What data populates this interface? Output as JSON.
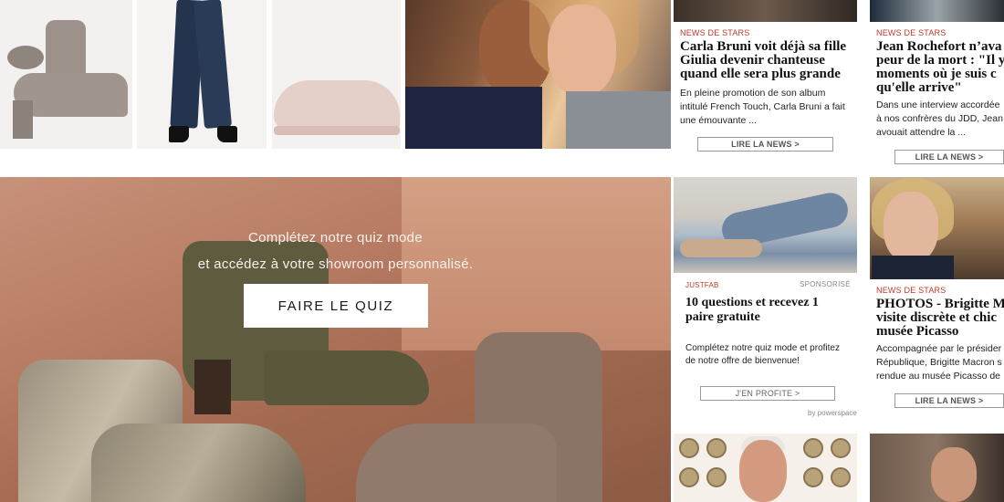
{
  "hero": {
    "line1": "Complétez notre quiz mode",
    "line2": "et accédez à votre showroom personnalisé.",
    "cta_label": "FAIRE LE QUIZ"
  },
  "news": [
    {
      "category": "NEWS DE STARS",
      "title_lines": [
        "Carla Bruni voit déjà sa fille",
        "Giulia devenir chanteuse",
        "quand elle sera plus grande"
      ],
      "desc_lines": [
        "En pleine promotion de son album",
        "intitulé French Touch, Carla Bruni a fait",
        "une émouvante ..."
      ],
      "button": "LIRE LA NEWS >"
    },
    {
      "category": "NEWS DE STARS",
      "title_lines": [
        "Jean Rochefort n’ava",
        "peur de la mort : \"Il y",
        "moments où je suis c",
        "qu'elle arrive\""
      ],
      "desc_lines": [
        "Dans une interview accordée",
        "à nos confrères du JDD, Jean",
        "avouait attendre la ..."
      ],
      "button": "LIRE LA NEWS >"
    },
    {
      "brand": "JUSTFAB",
      "sponsored": "SPONSORISÉ",
      "title_lines": [
        "10 questions et recevez 1",
        "paire gratuite"
      ],
      "desc_lines": [
        "Complétez notre quiz mode et profitez",
        "de notre offre de bienvenue!"
      ],
      "button": "J'EN PROFITE >",
      "byline": "by powerspace"
    },
    {
      "category": "NEWS DE STARS",
      "title_lines": [
        "PHOTOS - Brigitte Ma",
        "visite discrète et chic",
        "musée Picasso"
      ],
      "desc_lines": [
        "Accompagnée par le présider",
        "République, Brigitte Macron s",
        "rendue au musée Picasso de"
      ],
      "button": "LIRE LA NEWS >"
    }
  ]
}
